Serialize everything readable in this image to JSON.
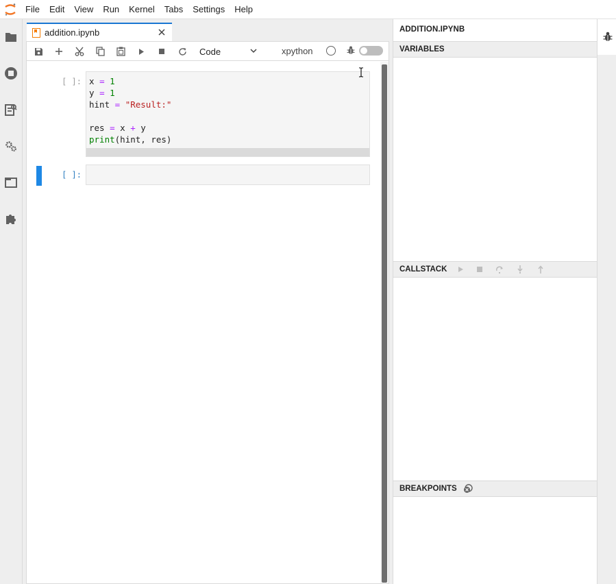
{
  "menu": [
    "File",
    "Edit",
    "View",
    "Run",
    "Kernel",
    "Tabs",
    "Settings",
    "Help"
  ],
  "tab": {
    "label": "addition.ipynb"
  },
  "toolbar": {
    "cell_type": "Code",
    "kernel_name": "xpython"
  },
  "cells": [
    {
      "prompt": "[ ]:",
      "lines": [
        "x = 1",
        "y = 1",
        "hint = \"Result:\"",
        "",
        "res = x + y",
        "print(hint, res)"
      ]
    },
    {
      "prompt": "[ ]:",
      "lines": []
    }
  ],
  "debugger": {
    "title": "ADDITION.IPYNB",
    "variables": "VARIABLES",
    "callstack": "CALLSTACK",
    "breakpoints": "BREAKPOINTS"
  },
  "icons": {
    "left_bar": [
      "folder-icon",
      "running-icon",
      "property-inspector-icon",
      "settings-icon",
      "tabs-icon",
      "extension-icon"
    ],
    "right_bar": [
      "bug-icon"
    ]
  },
  "colors": {
    "accent": "#1976d2",
    "active_cell": "#1e88e5"
  }
}
